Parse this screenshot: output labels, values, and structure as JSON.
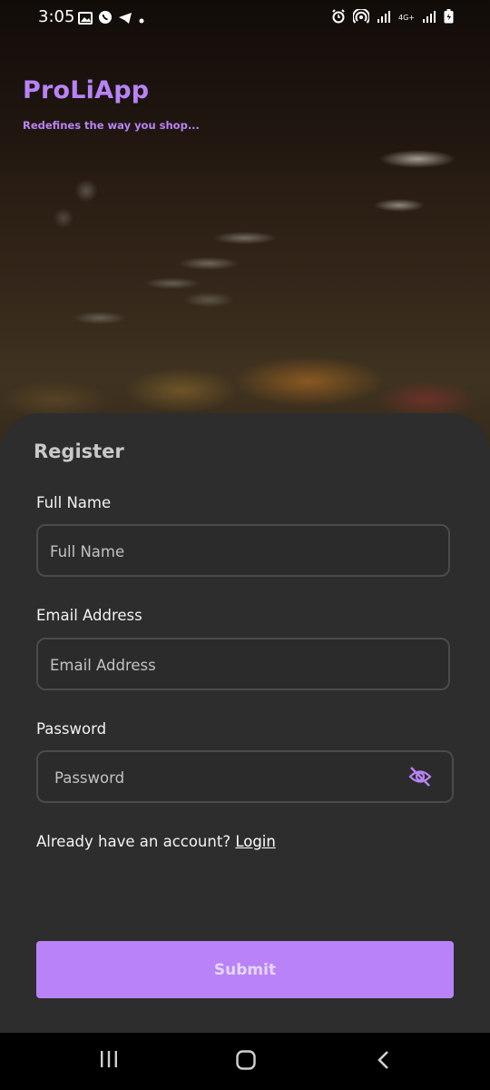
{
  "status_bar": {
    "time": "3:05",
    "left_icons": [
      "image-icon",
      "whatsapp-icon",
      "telegram-icon",
      "dot-icon"
    ],
    "right_icons": [
      "alarm-icon",
      "hotspot-icon",
      "signal-icon",
      "network-4g-icon",
      "signal-icon-2",
      "battery-icon"
    ],
    "network_label": "4G+"
  },
  "brand": {
    "title": "ProLiApp",
    "tagline": "Redefines the way you shop..."
  },
  "register": {
    "title": "Register",
    "full_name": {
      "label": "Full Name",
      "placeholder": "Full Name",
      "value": ""
    },
    "email": {
      "label": "Email Address",
      "placeholder": "Email Address",
      "value": ""
    },
    "password": {
      "label": "Password",
      "placeholder": "Password",
      "value": "",
      "toggle_icon": "eye-off-icon"
    },
    "account_prompt": "Already have an account?",
    "login_link": "Login",
    "submit_label": "Submit"
  },
  "colors": {
    "accent": "#b983f7",
    "card": "#2d2d2e",
    "input_border": "#4b4b4d",
    "navbar": "#000000"
  },
  "navbar": {
    "buttons": [
      "recent-apps-icon",
      "home-icon",
      "back-icon"
    ]
  }
}
